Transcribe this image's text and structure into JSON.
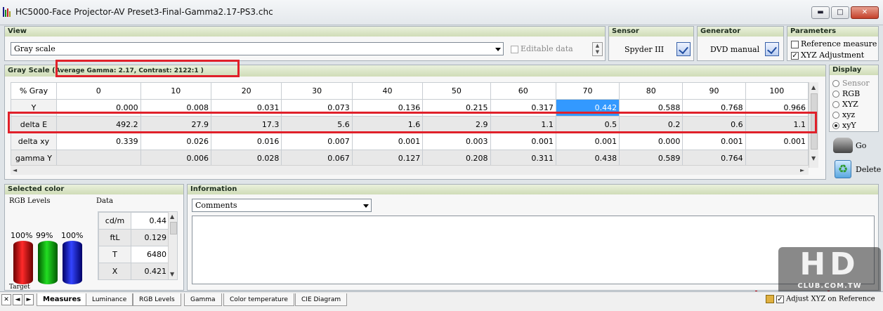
{
  "window": {
    "title": "HC5000-Face Projector-AV Preset3-Final-Gamma2.17-PS3.chc",
    "minimize": "▬",
    "maximize": "□",
    "close": "✕"
  },
  "view": {
    "header": "View",
    "selected": "Gray scale",
    "editable_label": "Editable data"
  },
  "sensor": {
    "header": "Sensor",
    "value": "Spyder III"
  },
  "generator": {
    "header": "Generator",
    "value": "DVD manual"
  },
  "parameters": {
    "header": "Parameters",
    "reference_measure": "Reference measure",
    "xyz_adjustment": "XYZ Adjustment"
  },
  "gray_scale": {
    "header_prefix": "Gray Scale (",
    "summary": "Average Gamma: 2.17, Contrast: 2122:1 )",
    "columns": [
      "% Gray",
      "0",
      "10",
      "20",
      "30",
      "40",
      "50",
      "60",
      "70",
      "80",
      "90",
      "100"
    ],
    "rows": [
      {
        "label": "Y",
        "values": [
          "0.000",
          "0.008",
          "0.031",
          "0.073",
          "0.136",
          "0.215",
          "0.317",
          "0.442",
          "0.588",
          "0.768",
          "0.966"
        ]
      },
      {
        "label": "delta E",
        "values": [
          "492.2",
          "27.9",
          "17.3",
          "5.6",
          "1.6",
          "2.9",
          "1.1",
          "0.5",
          "0.2",
          "0.6",
          "1.1"
        ]
      },
      {
        "label": "delta xy",
        "values": [
          "0.339",
          "0.026",
          "0.016",
          "0.007",
          "0.001",
          "0.003",
          "0.001",
          "0.001",
          "0.000",
          "0.001",
          "0.001"
        ]
      },
      {
        "label": "gamma Y",
        "values": [
          "",
          "0.006",
          "0.028",
          "0.067",
          "0.127",
          "0.208",
          "0.311",
          "0.438",
          "0.589",
          "0.764",
          ""
        ]
      }
    ]
  },
  "display": {
    "header": "Display",
    "options": [
      "Sensor",
      "RGB",
      "XYZ",
      "xyz",
      "xyY"
    ],
    "selected": "xyY",
    "go": "Go",
    "delete": "Delete"
  },
  "selected_color": {
    "header": "Selected color",
    "rgb_label": "RGB Levels",
    "data_label": "Data",
    "levels": [
      "100%",
      "99%",
      "100%"
    ],
    "target_label": "Target",
    "data_rows": [
      {
        "label": "cd/m",
        "value": "0.44"
      },
      {
        "label": "ftL",
        "value": "0.129"
      },
      {
        "label": "T",
        "value": "6480"
      },
      {
        "label": "X",
        "value": "0.421"
      }
    ]
  },
  "information": {
    "header": "Information",
    "selected": "Comments"
  },
  "tabs": [
    "Measures",
    "Luminance",
    "RGB Levels",
    "Gamma",
    "Color temperature",
    "CIE Diagram"
  ],
  "active_tab": "Measures",
  "status": {
    "adjust_label": "Adjust XYZ on Reference"
  },
  "watermark": {
    "line1": "HD",
    "line2": "CLUB.COM.TW"
  },
  "colors": {
    "highlight": "#3399ff",
    "annotation": "#e0202a",
    "header_green": "#cfdcb7"
  }
}
